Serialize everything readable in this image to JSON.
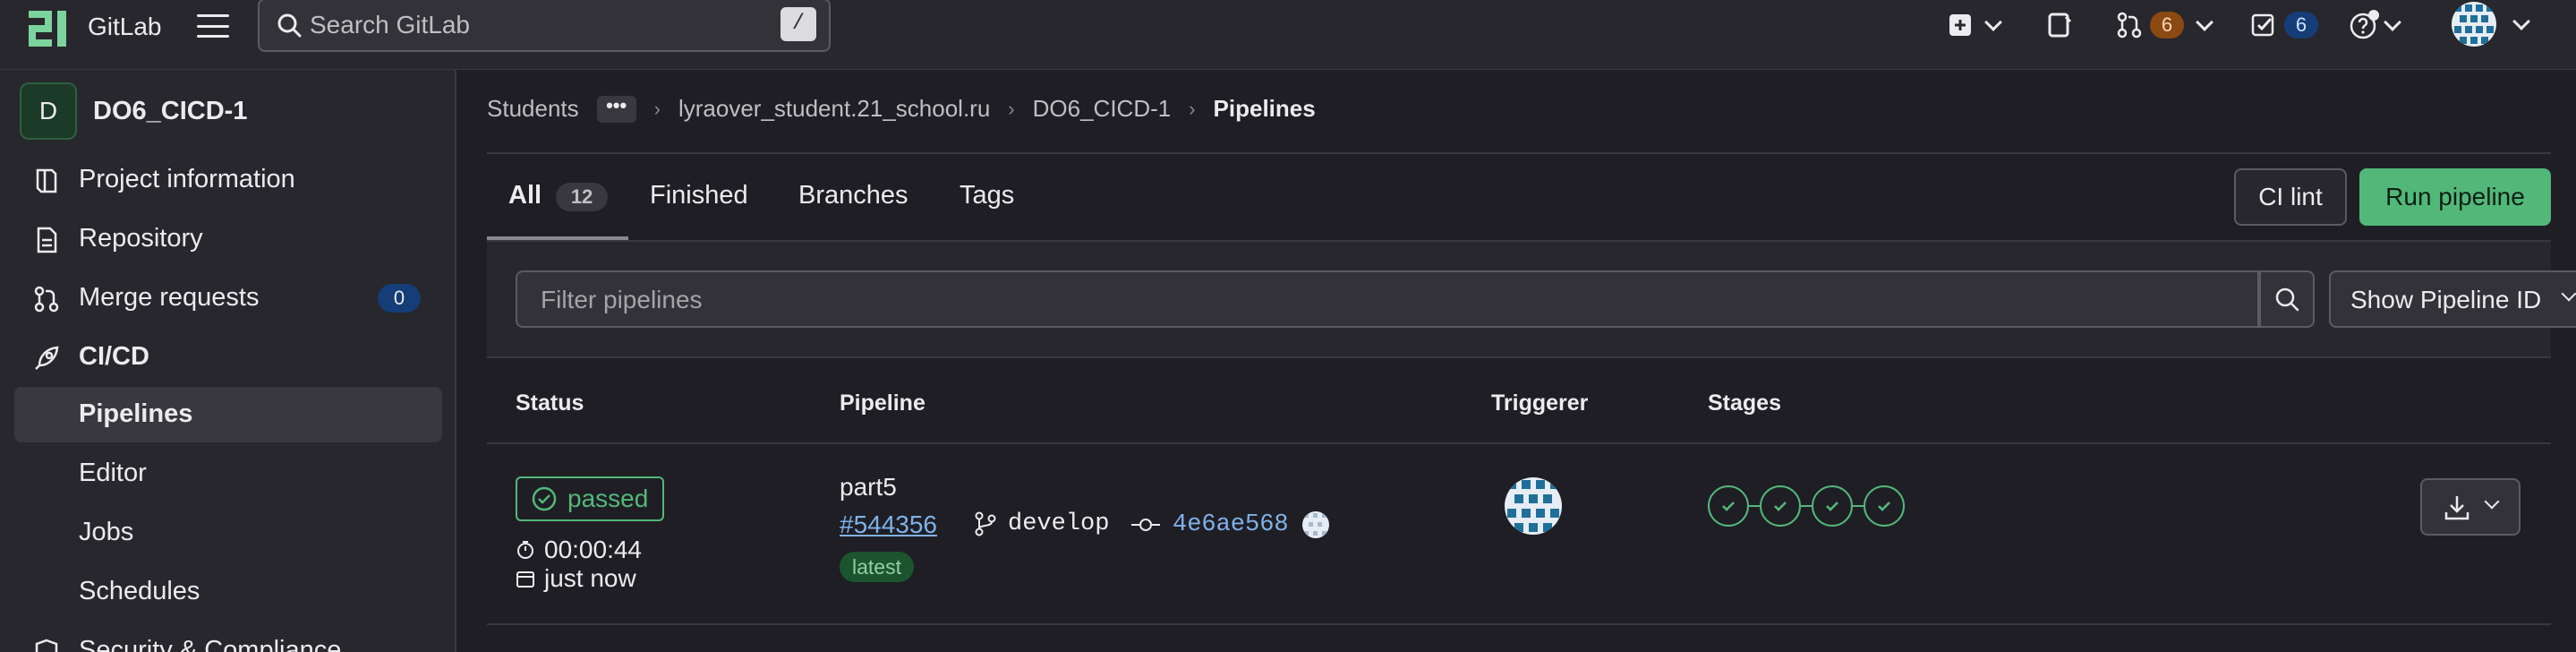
{
  "topbar": {
    "brand": "GitLab",
    "search_placeholder": "Search GitLab",
    "search_shortcut": "/",
    "merge_requests_count": "6",
    "todos_count": "6",
    "colors": {
      "mr_badge": "#8a4a12",
      "todo_badge": "#153d77"
    }
  },
  "project": {
    "avatar_letter": "D",
    "name": "DO6_CICD-1"
  },
  "sidebar": {
    "items": [
      {
        "label": "Project information",
        "icon": "project-icon"
      },
      {
        "label": "Repository",
        "icon": "document-icon"
      },
      {
        "label": "Merge requests",
        "icon": "merge-request-icon",
        "count": "0"
      },
      {
        "label": "CI/CD",
        "icon": "rocket-icon"
      },
      {
        "label": "Pipelines"
      },
      {
        "label": "Editor"
      },
      {
        "label": "Jobs"
      },
      {
        "label": "Schedules"
      },
      {
        "label": "Security & Compliance",
        "icon": "shield-icon"
      }
    ]
  },
  "breadcrumbs": {
    "items": [
      "Students",
      "lyraover_student.21_school.ru",
      "DO6_CICD-1"
    ],
    "current": "Pipelines"
  },
  "tabs": {
    "all_label": "All",
    "all_count": "12",
    "finished": "Finished",
    "branches": "Branches",
    "tags": "Tags"
  },
  "actions": {
    "ci_lint": "CI lint",
    "run_pipeline": "Run pipeline"
  },
  "filter": {
    "placeholder": "Filter pipelines",
    "show_id": "Show Pipeline ID"
  },
  "table": {
    "headers": {
      "status": "Status",
      "pipeline": "Pipeline",
      "triggerer": "Triggerer",
      "stages": "Stages"
    },
    "rows": [
      {
        "status": "passed",
        "duration": "00:00:44",
        "finished": "just now",
        "name": "part5",
        "id": "#544356",
        "branch": "develop",
        "commit": "4e6ae568",
        "tag": "latest",
        "stages_passed": 4
      }
    ]
  },
  "colors": {
    "success": "#52b87a",
    "link": "#7eb2ea",
    "bg": "#1f1e24",
    "panel": "#28272d"
  }
}
